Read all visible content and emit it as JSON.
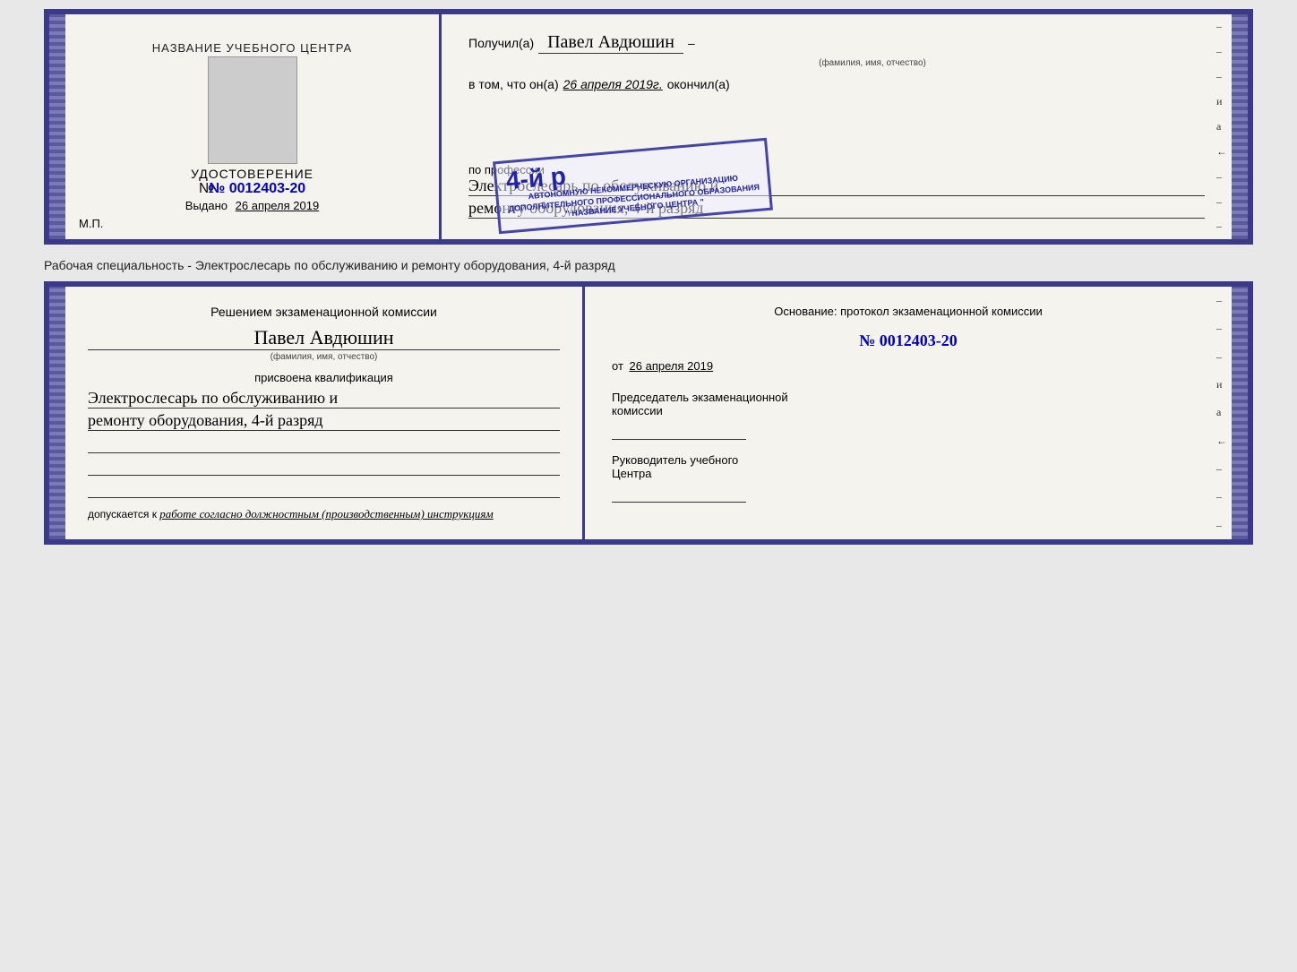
{
  "topCert": {
    "leftSide": {
      "title": "НАЗВАНИЕ УЧЕБНОГО ЦЕНТРА",
      "udostoverenie": "УДОСТОВЕРЕНИЕ",
      "number": "№ 0012403-20",
      "vydano": "Выдано",
      "vydanoDate": "26 апреля 2019",
      "mpLabel": "М.П."
    },
    "rightSide": {
      "poluchilLabel": "Получил(а)",
      "poluchilName": "Павел Авдюшин",
      "fioCaption": "(фамилия, имя, отчество)",
      "dashSymbol": "–",
      "vtomLabel": "в том, что он(а)",
      "vtomDate": "26 апреля 2019г.",
      "okonchilLabel": "окончил(а)",
      "stampLarge": "4-й р",
      "stampLine1": "АВТОНОМНУЮ НЕКОММЕРЧЕСКУЮ ОРГАНИЗАЦИЮ",
      "stampLine2": "ДОПОЛНИТЕЛЬНОГО ПРОФЕССИОНАЛЬНОГО ОБРАЗОВАНИЯ",
      "stampLine3": "\" НАЗВАНИЕ УЧЕБНОГО ЦЕНТРА \"",
      "poProfessii": "по профессии",
      "profLine1": "Электрослесарь по обслуживанию и",
      "profLine2": "ремонту оборудования, 4-й разряд"
    }
  },
  "separatorText": "Рабочая специальность - Электрослесарь по обслуживанию и ремонту оборудования, 4-й разряд",
  "bottomCert": {
    "leftSide": {
      "resheniemTitle": "Решением экзаменационной комиссии",
      "name": "Павел Авдюшин",
      "fioCaption": "(фамилия, имя, отчество)",
      "prisvoenaLabel": "присвоена квалификация",
      "kvalifLine1": "Электрослесарь по обслуживанию и",
      "kvalifLine2": "ремонту оборудования, 4-й разряд",
      "dopuskaetsyaLabel": "допускается к",
      "dopuskaetsyaText": "работе согласно должностным (производственным) инструкциям"
    },
    "rightSide": {
      "osnovanieLable": "Основание: протокол экзаменационной комиссии",
      "number": "№ 0012403-20",
      "otLabel": "от",
      "otDate": "26 апреля 2019",
      "chairmanLine1": "Председатель экзаменационной",
      "chairmanLine2": "комиссии",
      "rukovoditelLine1": "Руководитель учебного",
      "rukovoditelLine2": "Центра"
    }
  },
  "sideDashes": [
    "-",
    "-",
    "-",
    "и",
    "а",
    "←",
    "-",
    "-",
    "-"
  ]
}
